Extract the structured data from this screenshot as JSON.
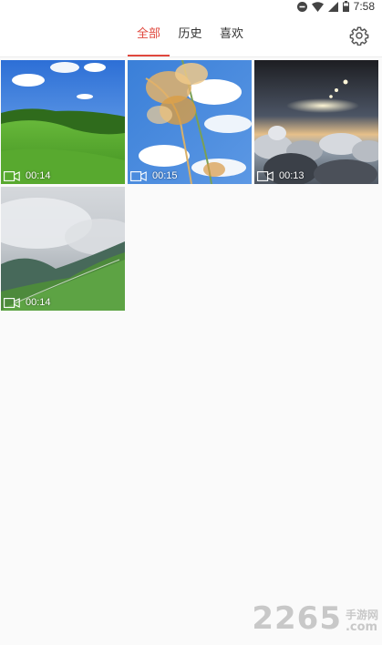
{
  "status_bar": {
    "time": "7:58",
    "icons": [
      "do-not-disturb-icon",
      "wifi-icon",
      "signal-icon",
      "battery-icon"
    ]
  },
  "tabs": [
    {
      "label": "全部",
      "active": true
    },
    {
      "label": "历史",
      "active": false
    },
    {
      "label": "喜欢",
      "active": false
    }
  ],
  "header": {
    "settings_icon": "gear-icon"
  },
  "videos": [
    {
      "duration": "00:14",
      "scene": "green-hill-blue-sky"
    },
    {
      "duration": "00:15",
      "scene": "reed-grass-blue-sky"
    },
    {
      "duration": "00:13",
      "scene": "sunset-above-clouds"
    },
    {
      "duration": "00:14",
      "scene": "misty-mountain-ridge"
    }
  ],
  "watermark": {
    "number": "2265",
    "cn_text": "手游网",
    "domain": ".com"
  },
  "colors": {
    "accent": "#e0483e",
    "background": "#fafafa"
  }
}
